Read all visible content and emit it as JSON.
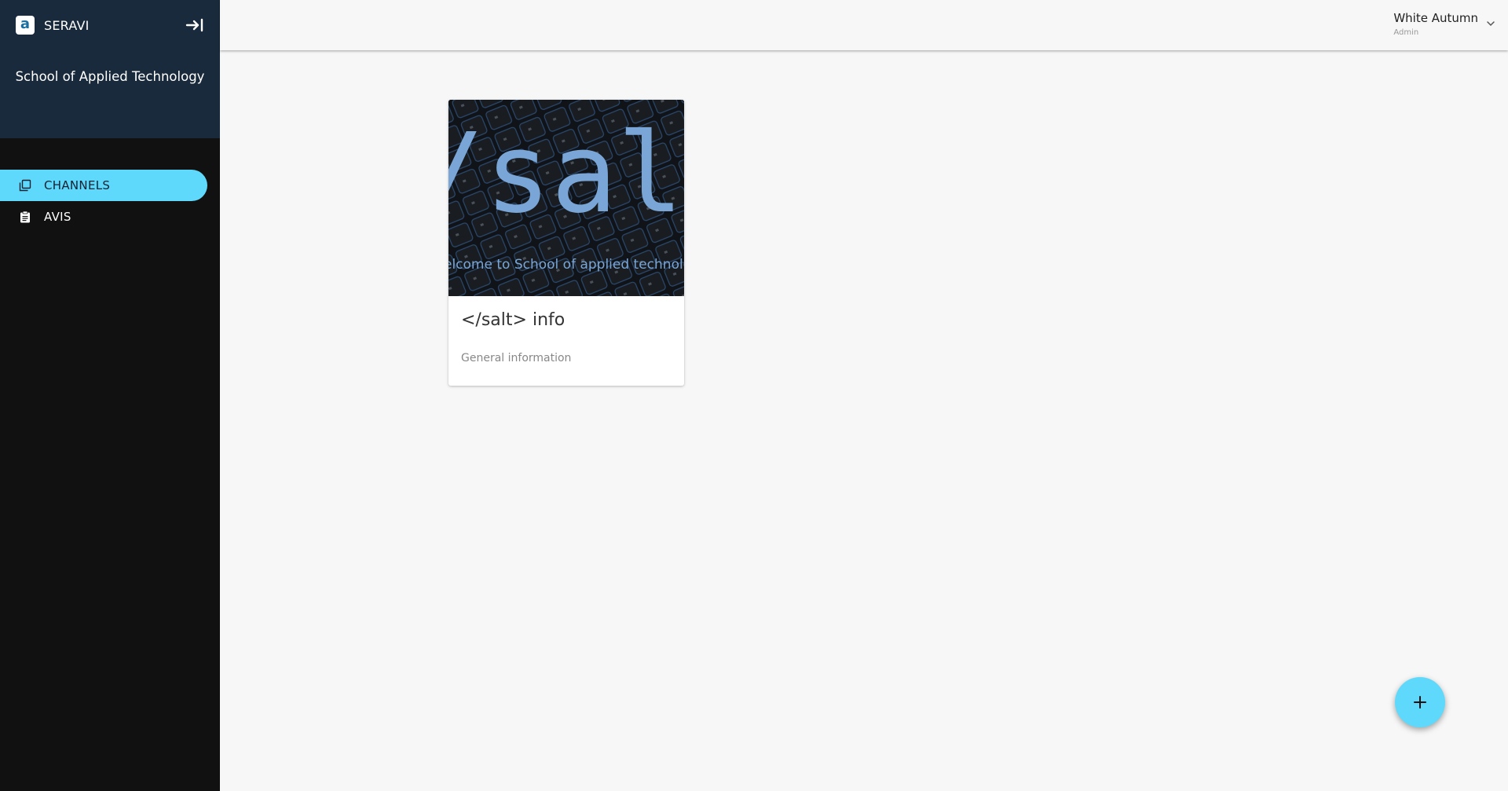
{
  "app": {
    "brand": "SERAVI",
    "logo_letter": "a"
  },
  "sidebar": {
    "school": "School of Applied Technology",
    "items": [
      {
        "label": "CHANNELS",
        "icon": "library-books-icon",
        "active": true
      },
      {
        "label": "AVIS",
        "icon": "clipboard-icon",
        "active": false
      }
    ]
  },
  "user": {
    "name": "White Autumn",
    "role": "Admin"
  },
  "channels": [
    {
      "title": "</salt> info",
      "subtitle": "General information",
      "image_text_big": "/salt",
      "image_text_small": "elcome to School of applied technolo"
    }
  ],
  "colors": {
    "accent": "#5fd9fb",
    "sidebar_header": "#1a2a3d",
    "sidebar": "#111111",
    "background": "#f7f7f7"
  }
}
